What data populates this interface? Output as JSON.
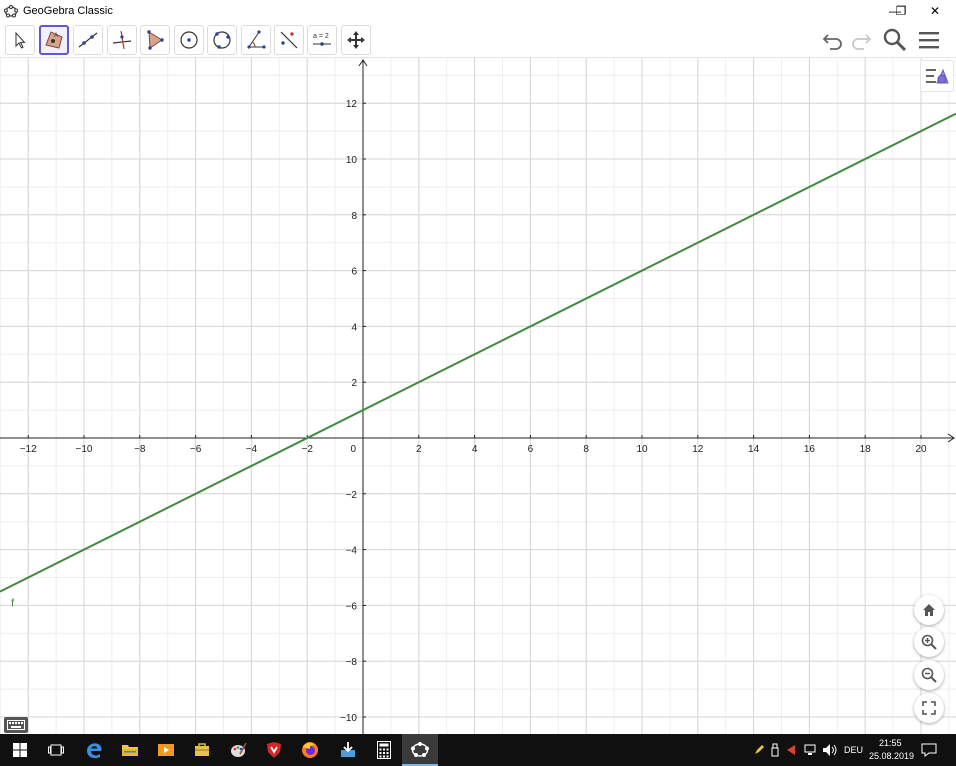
{
  "window": {
    "title": "GeoGebra Classic",
    "minimize_glyph": "—",
    "restore_glyph": "❐",
    "close_glyph": "✕"
  },
  "toolbar": {
    "tools": [
      {
        "name": "move-tool",
        "icon": "arrow-cursor-icon"
      },
      {
        "name": "point-tool",
        "icon": "point-in-polygon-icon",
        "active": true
      },
      {
        "name": "line-tool",
        "icon": "line-through-points-icon"
      },
      {
        "name": "perpendicular-line-tool",
        "icon": "perpendicular-icon"
      },
      {
        "name": "polygon-tool",
        "icon": "polygon-icon"
      },
      {
        "name": "circle-center-point-tool",
        "icon": "circle-center-icon"
      },
      {
        "name": "circle-three-points-tool",
        "icon": "circle-three-points-icon"
      },
      {
        "name": "angle-tool",
        "icon": "angle-icon"
      },
      {
        "name": "reflect-tool",
        "icon": "reflect-line-icon"
      },
      {
        "name": "slider-tool",
        "icon": "slider-icon",
        "label": "a = 2"
      },
      {
        "name": "move-graphics-view-tool",
        "icon": "move-arrows-icon"
      }
    ],
    "right": [
      "undo-icon",
      "redo-icon",
      "search-icon",
      "menu-icon"
    ]
  },
  "graph": {
    "x_ticks": [
      "-12",
      "-10",
      "-8",
      "-6",
      "-4",
      "-2",
      "0",
      "2",
      "4",
      "6",
      "8",
      "10",
      "12",
      "14",
      "16",
      "18",
      "20"
    ],
    "y_ticks": [
      "12",
      "10",
      "8",
      "6",
      "4",
      "2",
      "-2",
      "-4",
      "-6",
      "-8",
      "-10"
    ],
    "function_label": "f",
    "line_color": "#3f8b3b",
    "slope": 0.5,
    "intercept": 1
  },
  "taskbar": {
    "language": "DEU",
    "time": "21:55",
    "date": "25.08.2019"
  }
}
